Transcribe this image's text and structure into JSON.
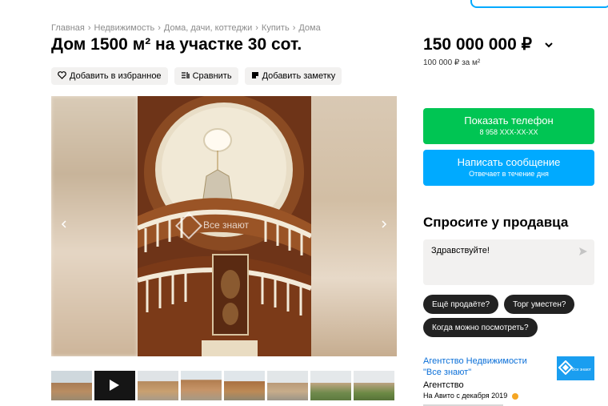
{
  "breadcrumb": {
    "items": [
      "Главная",
      "Недвижимость",
      "Дома, дачи, коттеджи",
      "Купить",
      "Дома"
    ],
    "separator": "›"
  },
  "listing": {
    "title": "Дом 1500 м² на участке 30 сот.",
    "price": "150 000 000 ₽",
    "price_per_m2": "100 000 ₽ за м²"
  },
  "actions": {
    "favorite_label": "Добавить в избранное",
    "compare_label": "Сравнить",
    "note_label": "Добавить заметку"
  },
  "gallery": {
    "watermark": "Все знают",
    "prev_icon": "chevron-left-icon",
    "next_icon": "chevron-right-icon",
    "thumbnail_count": 8
  },
  "contact": {
    "phone_label": "Показать телефон",
    "phone_number": "8 958 XXX-XX-XX",
    "message_label": "Написать сообщение",
    "message_sub": "Отвечает в течение дня",
    "phone_color": "#00c553",
    "message_color": "#00aaff"
  },
  "ask": {
    "title": "Спросите у продавца",
    "input_value": "Здравствуйте!",
    "chips": [
      "Ещё продаёте?",
      "Торг уместен?",
      "Когда можно посмотреть?"
    ]
  },
  "seller": {
    "name": "Агентство Недвижимости \"Все знают\"",
    "type": "Агентство",
    "since": "На Авито с декабря 2019",
    "logo_text": "Все знают"
  }
}
